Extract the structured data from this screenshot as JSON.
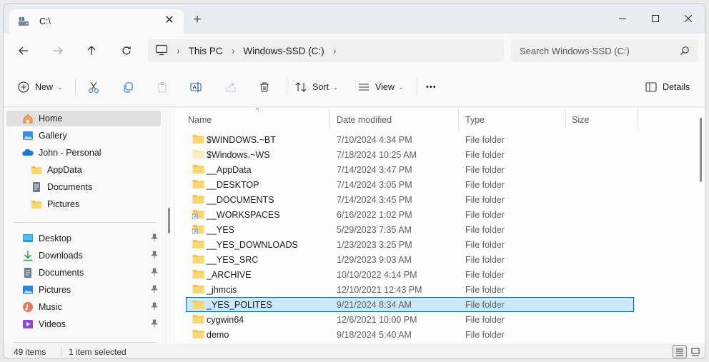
{
  "tab": {
    "title": "C:\\",
    "close_glyph": "✕"
  },
  "window_controls": {
    "minimize": "—",
    "maximize": "☐",
    "close": "✕"
  },
  "new_tab_glyph": "+",
  "nav": {
    "back": "←",
    "forward": "→",
    "up": "↑",
    "refresh": "↻"
  },
  "address": {
    "crumbs": [
      "This PC",
      "Windows-SSD (C:)"
    ],
    "sep": "›"
  },
  "search": {
    "placeholder": "Search Windows-SSD (C:)"
  },
  "toolbar": {
    "new_label": "New",
    "sort_label": "Sort",
    "view_label": "View",
    "more_label": "•••",
    "details_label": "Details",
    "caret": "⌄"
  },
  "sidebar": {
    "items": [
      {
        "label": "Home",
        "icon": "home-icon"
      },
      {
        "label": "Gallery",
        "icon": "gallery-icon"
      },
      {
        "label": "John - Personal",
        "icon": "onedrive-icon"
      },
      {
        "label": "AppData",
        "icon": "folder-icon"
      },
      {
        "label": "Documents",
        "icon": "documents-icon"
      },
      {
        "label": "Pictures",
        "icon": "folder-icon"
      },
      {
        "label": "Desktop",
        "icon": "desktop-icon"
      },
      {
        "label": "Downloads",
        "icon": "download-icon"
      },
      {
        "label": "Documents",
        "icon": "documents-icon"
      },
      {
        "label": "Pictures",
        "icon": "pictures-icon"
      },
      {
        "label": "Music",
        "icon": "music-icon"
      },
      {
        "label": "Videos",
        "icon": "videos-icon"
      }
    ],
    "pin_glyph": "📌"
  },
  "columns": {
    "name": "Name",
    "date": "Date modified",
    "type": "Type",
    "size": "Size",
    "sort_glyph": "^"
  },
  "files": [
    {
      "name": "$WINDOWS.~BT",
      "date": "7/10/2024 4:34 PM",
      "type": "File folder"
    },
    {
      "name": "$Windows.~WS",
      "date": "7/18/2024 10:25 AM",
      "type": "File folder"
    },
    {
      "name": "__AppData",
      "date": "7/14/2024 3:47 PM",
      "type": "File folder"
    },
    {
      "name": "__DESKTOP",
      "date": "7/14/2024 3:05 PM",
      "type": "File folder"
    },
    {
      "name": "__DOCUMENTS",
      "date": "7/14/2024 3:45 PM",
      "type": "File folder"
    },
    {
      "name": "__WORKSPACES",
      "date": "6/16/2022 1:02 PM",
      "type": "File folder"
    },
    {
      "name": "__YES",
      "date": "5/29/2023 7:35 AM",
      "type": "File folder"
    },
    {
      "name": "__YES_DOWNLOADS",
      "date": "1/23/2023 3:25 PM",
      "type": "File folder"
    },
    {
      "name": "__YES_SRC",
      "date": "1/29/2023 9:03 AM",
      "type": "File folder"
    },
    {
      "name": "_ARCHIVE",
      "date": "10/10/2022 4:14 PM",
      "type": "File folder"
    },
    {
      "name": "_jhmcis",
      "date": "12/10/2021 12:43 PM",
      "type": "File folder"
    },
    {
      "name": "_YES_POLITES",
      "date": "9/21/2024 8:34 AM",
      "type": "File folder"
    },
    {
      "name": "cygwin64",
      "date": "12/6/2021 10:00 PM",
      "type": "File folder"
    },
    {
      "name": "demo",
      "date": "9/18/2024 5:40 AM",
      "type": "File folder"
    }
  ],
  "status": {
    "count": "49 items",
    "selected": "1 item selected"
  },
  "colors": {
    "folder": "#f4c542",
    "accent": "#0067c0",
    "selection": "#cce8ff"
  }
}
